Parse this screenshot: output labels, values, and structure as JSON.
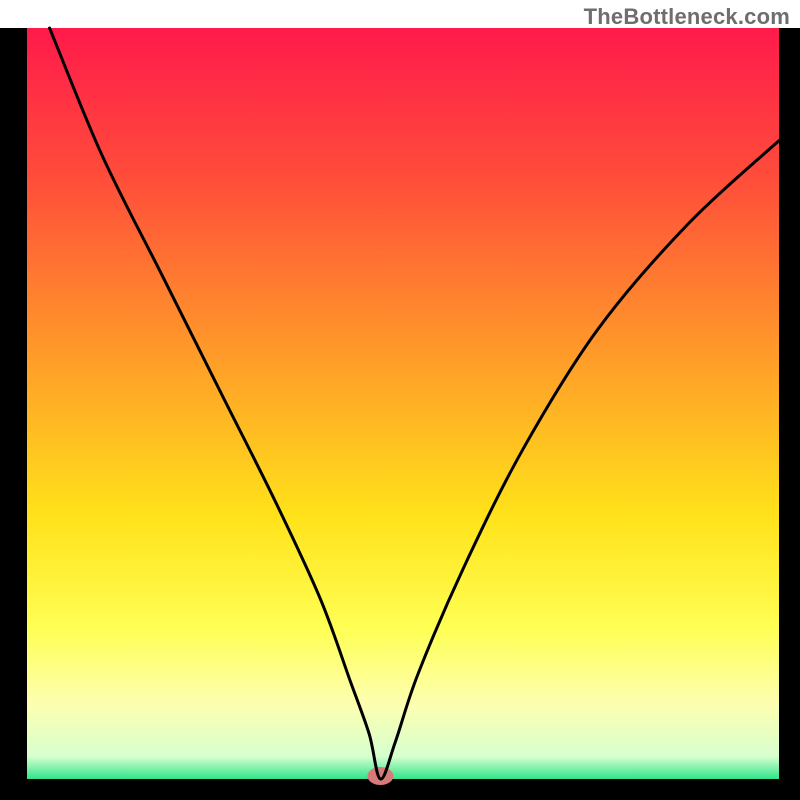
{
  "watermark": "TheBottleneck.com",
  "chart_data": {
    "type": "line",
    "title": "",
    "xlabel": "",
    "ylabel": "",
    "xlim": [
      0,
      100
    ],
    "ylim": [
      0,
      100
    ],
    "background_gradient": [
      {
        "stop": 0,
        "color": "#ff1a4b"
      },
      {
        "stop": 20,
        "color": "#ff4d3a"
      },
      {
        "stop": 45,
        "color": "#ffa028"
      },
      {
        "stop": 65,
        "color": "#ffe21a"
      },
      {
        "stop": 80,
        "color": "#ffff55"
      },
      {
        "stop": 90,
        "color": "#fdffb0"
      },
      {
        "stop": 97,
        "color": "#d7ffcf"
      },
      {
        "stop": 100,
        "color": "#2fe58a"
      }
    ],
    "marker": {
      "x": 47,
      "y": 0,
      "color": "#d77a7a"
    },
    "series": [
      {
        "name": "curve",
        "x": [
          3,
          10,
          18,
          26,
          33,
          39,
          43,
          45.5,
          47,
          49,
          52,
          58,
          66,
          76,
          88,
          100
        ],
        "y": [
          100,
          83,
          67,
          51,
          37,
          24,
          13,
          6,
          0,
          5,
          14,
          28,
          44,
          60,
          74,
          85
        ]
      }
    ]
  }
}
